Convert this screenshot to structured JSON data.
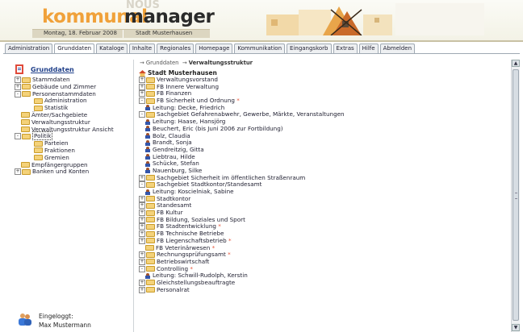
{
  "header": {
    "logo_orange": "kommunal",
    "logo_dark": "manager",
    "logo_ghost": "NOUS",
    "date": "Montag, 18. Februar 2008",
    "city": "Stadt Musterhausen"
  },
  "tabs": [
    "Administration",
    "Grunddaten",
    "Kataloge",
    "Inhalte",
    "Regionales",
    "Homepage",
    "Kommunikation",
    "Eingangskorb",
    "Extras",
    "Hilfe",
    "Abmelden"
  ],
  "active_tab": "Grunddaten",
  "sidebar": {
    "title": "Grunddaten",
    "items": [
      {
        "label": "Stammdaten",
        "pm": "+",
        "indent": 0
      },
      {
        "label": "Gebäude und Zimmer",
        "pm": "+",
        "indent": 0
      },
      {
        "label": "Personenstammdaten",
        "pm": "-",
        "indent": 0
      },
      {
        "label": "Administration",
        "pm": "",
        "indent": 1
      },
      {
        "label": "Statistik",
        "pm": "",
        "indent": 1
      },
      {
        "label": "Ämter/Sachgebiete",
        "pm": "",
        "indent": 0
      },
      {
        "label": "Verwaltungsstruktur",
        "pm": "",
        "indent": 0
      },
      {
        "label": "Verwaltungsstruktur Ansicht",
        "pm": "",
        "indent": 0
      },
      {
        "label": "Politik",
        "pm": "-",
        "indent": 0,
        "selected": true
      },
      {
        "label": "Parteien",
        "pm": "",
        "indent": 1
      },
      {
        "label": "Fraktionen",
        "pm": "",
        "indent": 1
      },
      {
        "label": "Gremien",
        "pm": "",
        "indent": 1
      },
      {
        "label": "Empfängergruppen",
        "pm": "",
        "indent": 0
      },
      {
        "label": "Banken und Konten",
        "pm": "+",
        "indent": 0
      }
    ]
  },
  "login": {
    "label": "Eingeloggt:",
    "user": "Max Mustermann"
  },
  "breadcrumb": {
    "item1": "Grunddaten",
    "item2": "Verwaltungsstruktur"
  },
  "main": {
    "root": "Stadt Musterhausen",
    "items": [
      {
        "t": "f",
        "pm": "+",
        "label": "Verwaltungsvorstand"
      },
      {
        "t": "f",
        "pm": "+",
        "label": "FB Innere Verwaltung"
      },
      {
        "t": "f",
        "pm": "+",
        "label": "FB Finanzen"
      },
      {
        "t": "f",
        "pm": "-",
        "label": "FB Sicherheit und Ordnung",
        "star": true
      },
      {
        "t": "p",
        "label": "Leitung: Decke, Friedrich"
      },
      {
        "t": "f",
        "pm": "-",
        "label": "Sachgebiet Gefahrenabwehr, Gewerbe, Märkte, Veranstaltungen"
      },
      {
        "t": "p",
        "label": "Leitung: Haase, Hansjörg"
      },
      {
        "t": "p",
        "label": "Beuchert, Eric (bis Juni 2006 zur Fortbildung)"
      },
      {
        "t": "p",
        "label": "Bolz, Claudia"
      },
      {
        "t": "p",
        "label": "Brandt, Sonja"
      },
      {
        "t": "p",
        "label": "Gendreitzig, Gitta"
      },
      {
        "t": "p",
        "label": "Liebtrau, Hilde"
      },
      {
        "t": "p",
        "label": "Schücke, Stefan"
      },
      {
        "t": "p",
        "label": "Nauenburg, Silke"
      },
      {
        "t": "f",
        "pm": "+",
        "label": "Sachgebiet Sicherheit im öffentlichen Straßenraum"
      },
      {
        "t": "f",
        "pm": "-",
        "label": "Sachgebiet Stadtkontor/Standesamt"
      },
      {
        "t": "p",
        "label": "Leitung: Koscielniak, Sabine"
      },
      {
        "t": "f",
        "pm": "+",
        "label": "Stadtkontor"
      },
      {
        "t": "f",
        "pm": "+",
        "label": "Standesamt"
      },
      {
        "t": "f",
        "pm": "+",
        "label": "FB Kultur"
      },
      {
        "t": "f",
        "pm": "+",
        "label": "FB Bildung, Soziales und Sport"
      },
      {
        "t": "f",
        "pm": "+",
        "label": "FB Stadtentwicklung",
        "star": true
      },
      {
        "t": "f",
        "pm": "+",
        "label": "FB Technische Betriebe"
      },
      {
        "t": "f",
        "pm": "+",
        "label": "FB Liegenschaftsbetrieb",
        "star": true
      },
      {
        "t": "f",
        "pm": "",
        "label": "FB Veterinärwesen",
        "star": true
      },
      {
        "t": "f",
        "pm": "+",
        "label": "Rechnungsprüfungsamt",
        "star": true
      },
      {
        "t": "f",
        "pm": "+",
        "label": "Betriebswirtschaft"
      },
      {
        "t": "f",
        "pm": "-",
        "label": "Controlling",
        "star": true
      },
      {
        "t": "p",
        "label": "Leitung: Schwill-Rudolph, Kerstin"
      },
      {
        "t": "f",
        "pm": "+",
        "label": "Gleichstellungsbeauftragte"
      },
      {
        "t": "f",
        "pm": "+",
        "label": "Personalrat"
      }
    ]
  },
  "colors": {
    "accent": "#f0a13a",
    "link": "#20408a",
    "star": "#e8553a"
  }
}
